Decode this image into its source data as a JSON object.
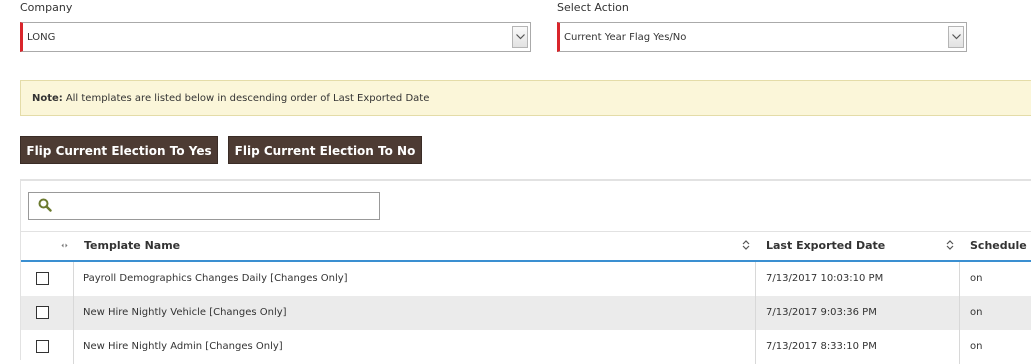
{
  "company": {
    "label": "Company",
    "value": "LONG"
  },
  "action": {
    "label": "Select Action",
    "value": "Current Year Flag Yes/No"
  },
  "note": {
    "title": "Note:",
    "text": "All templates are listed below in descending order of Last Exported Date"
  },
  "buttons": {
    "flip_yes": "Flip Current Election To Yes",
    "flip_no": "Flip Current Election To No"
  },
  "search": {
    "placeholder": "",
    "value": ""
  },
  "table": {
    "columns": {
      "template_name": "Template Name",
      "last_exported": "Last Exported Date",
      "schedule": "Schedule"
    },
    "rows": [
      {
        "name": "Payroll Demographics Changes Daily [Changes Only]",
        "date": "7/13/2017 10:03:10 PM",
        "schedule": "on"
      },
      {
        "name": "New Hire Nightly Vehicle [Changes Only]",
        "date": "7/13/2017 9:03:36 PM",
        "schedule": "on"
      },
      {
        "name": "New Hire Nightly Admin [Changes Only]",
        "date": "7/13/2017 8:33:10 PM",
        "schedule": "on"
      }
    ]
  },
  "colors": {
    "required_marker": "#d9252b",
    "button_bg": "#4d3b33",
    "note_bg": "#fbf6d9",
    "header_underline": "#3a8fd1",
    "row_alt": "#ebebeb"
  }
}
